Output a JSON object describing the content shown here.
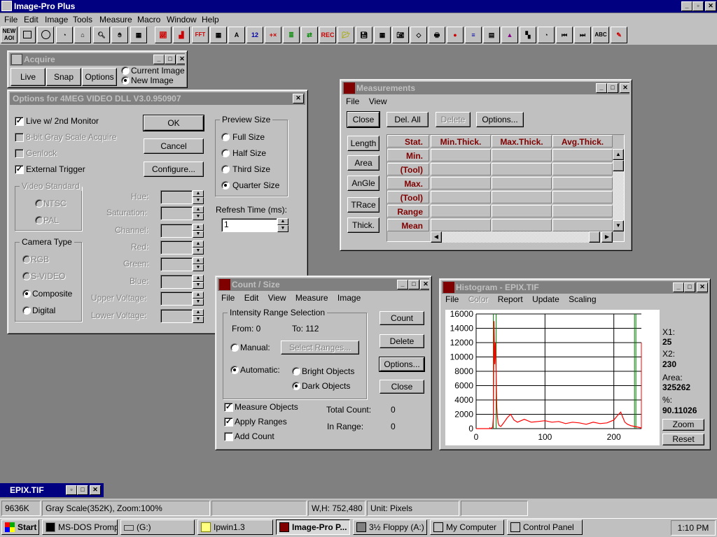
{
  "app": {
    "title": "Image-Pro Plus"
  },
  "menu": [
    "File",
    "Edit",
    "Image",
    "Tools",
    "Measure",
    "Macro",
    "Window",
    "Help"
  ],
  "toolbar": {
    "new_aoi": "NEW AOI",
    "rec": "REC",
    "abc": "ABC"
  },
  "acquire": {
    "title": "Acquire",
    "live": "Live",
    "snap": "Snap",
    "options": "Options",
    "current_image": "Current Image",
    "new_image": "New Image"
  },
  "options_dialog": {
    "title": "Options for 4MEG VIDEO DLL V3.0.950907",
    "live_2nd": "Live w/ 2nd Monitor",
    "gray8": "8-bit Gray Scale Acquire",
    "genlock": "Genlock",
    "ext_trigger": "External Trigger",
    "ok": "OK",
    "cancel": "Cancel",
    "configure": "Configure...",
    "video_standard": "Video Standard",
    "ntsc": "NTSC",
    "pal": "PAL",
    "camera_type": "Camera Type",
    "rgb": "RGB",
    "svideo": "S-VIDEO",
    "composite": "Composite",
    "digital": "Digital",
    "hue": "Hue:",
    "saturation": "Saturation:",
    "channel": "Channel:",
    "red": "Red:",
    "green": "Green:",
    "blue": "Blue:",
    "upper_voltage": "Upper Voltage:",
    "lower_voltage": "Lower Voltage:",
    "preview_size": "Preview Size",
    "full_size": "Full Size",
    "half_size": "Half Size",
    "third_size": "Third Size",
    "quarter_size": "Quarter Size",
    "refresh_time": "Refresh Time (ms):",
    "refresh_value": "1"
  },
  "measurements": {
    "title": "Measurements",
    "menu": [
      "File",
      "View"
    ],
    "close": "Close",
    "del_all": "Del. All",
    "delete": "Delete",
    "options": "Options...",
    "side_buttons": [
      "Length",
      "Area",
      "AnGle",
      "TRace",
      "Thick."
    ],
    "columns": [
      "Stat.",
      "Min.Thick.",
      "Max.Thick.",
      "Avg.Thick."
    ],
    "rows": [
      "Min.",
      "(Tool)",
      "Max.",
      "(Tool)",
      "Range",
      "Mean"
    ]
  },
  "count_size": {
    "title": "Count / Size",
    "menu": [
      "File",
      "Edit",
      "View",
      "Measure",
      "Image"
    ],
    "intensity_range": "Intensity Range Selection",
    "from": "From: 0",
    "to": "To: 112",
    "manual": "Manual:",
    "select_ranges": "Select Ranges...",
    "automatic": "Automatic:",
    "bright_objects": "Bright Objects",
    "dark_objects": "Dark Objects",
    "count": "Count",
    "delete": "Delete",
    "options": "Options...",
    "close": "Close",
    "measure_objects": "Measure Objects",
    "apply_ranges": "Apply Ranges",
    "add_count": "Add Count",
    "total_count_label": "Total Count:",
    "total_count": "0",
    "in_range_label": "In Range:",
    "in_range": "0"
  },
  "histogram": {
    "title": "Histogram - EPIX.TIF",
    "menu": [
      "File",
      "Color",
      "Report",
      "Update",
      "Scaling"
    ],
    "x1_label": "X1:",
    "x1": "25",
    "x2_label": "X2:",
    "x2": "230",
    "area_label": "Area:",
    "area": "325262",
    "pct_label": "%:",
    "pct": "90.11026",
    "zoom": "Zoom",
    "reset": "Reset"
  },
  "chart_data": {
    "type": "line",
    "xlim": [
      0,
      240
    ],
    "ylim": [
      0,
      16000
    ],
    "yticks": [
      0,
      2000,
      4000,
      6000,
      8000,
      10000,
      12000,
      14000,
      16000
    ],
    "xticks": [
      0,
      100,
      200
    ],
    "x": [
      0,
      10,
      20,
      22,
      24,
      25,
      26,
      27,
      28,
      29,
      30,
      31,
      32,
      33,
      34,
      36,
      40,
      45,
      50,
      55,
      60,
      70,
      80,
      90,
      100,
      110,
      120,
      130,
      140,
      150,
      160,
      170,
      180,
      190,
      200,
      205,
      210,
      213,
      216,
      220,
      225,
      230,
      235,
      240
    ],
    "series": [
      {
        "values": [
          0,
          0,
          0,
          50,
          200,
          1500,
          15000,
          9000,
          12000,
          8000,
          3000,
          1500,
          800,
          500,
          400,
          300,
          800,
          1500,
          2000,
          1200,
          900,
          1300,
          900,
          1000,
          1100,
          900,
          1000,
          700,
          900,
          800,
          600,
          900,
          700,
          800,
          1200,
          1800,
          2300,
          1600,
          900,
          600,
          400,
          300,
          200,
          100
        ]
      }
    ],
    "range_markers": {
      "x1": 25,
      "x2": 230
    },
    "colors": {
      "line": "#ff0000",
      "markers": "#008000",
      "grid": "#000000"
    }
  },
  "epix": {
    "title": "EPIX.TIF"
  },
  "statusbar": {
    "mem": "9636K",
    "mode": "Gray Scale(352K), Zoom:100%",
    "blank": "",
    "wh": "W,H: 752,480",
    "unit": "Unit: Pixels",
    "blank2": ""
  },
  "taskbar": {
    "start": "Start",
    "items": [
      "MS-DOS Prompt",
      "(G:)",
      "Ipwin1.3",
      "Image-Pro P...",
      "3½ Floppy (A:)",
      "My Computer",
      "Control Panel"
    ],
    "clock": "1:10 PM"
  }
}
